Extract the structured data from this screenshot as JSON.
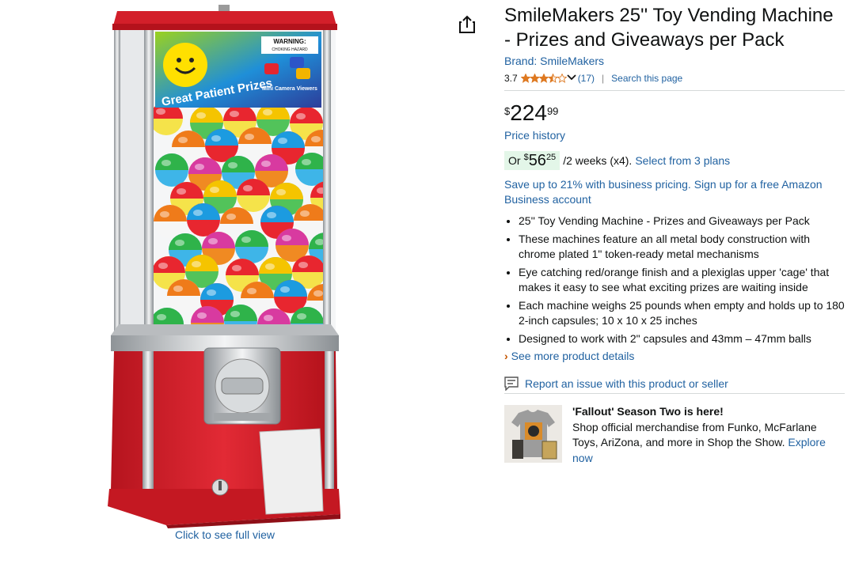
{
  "product": {
    "title": "SmileMakers 25'' Toy Vending Machine - Prizes and Giveaways per Pack",
    "brand": "Brand: SmileMakers",
    "rating_value": "3.7",
    "rating_stars": 3.5,
    "rating_count": "(17)",
    "search_page": "Search this page"
  },
  "price": {
    "symbol": "$",
    "whole": "224",
    "fraction": "99",
    "history_link": "Price history"
  },
  "installment": {
    "or": "Or",
    "symbol": "$",
    "whole": "56",
    "fraction": "25",
    "per": "/2 weeks (x4).",
    "plans_link": "Select from 3 plans"
  },
  "business": "Save up to 21% with business pricing. Sign up for a free Amazon Business account",
  "bullets": [
    "25'' Toy Vending Machine - Prizes and Giveaways per Pack",
    "These machines feature an all metal body construction with chrome plated 1\" token-ready metal mechanisms",
    "Eye catching red/orange finish and a plexiglas upper 'cage' that makes it easy to see what exciting prizes are waiting inside",
    "Each machine weighs 25 pounds when empty and holds up to 180 2-inch capsules; 10 x 10 x 25 inches",
    "Designed to work with 2\" capsules and 43mm – 47mm balls"
  ],
  "see_more": "See more product details",
  "report_issue": "Report an issue with this product or seller",
  "promo": {
    "title": "'Fallout' Season Two is here!",
    "body": "Shop official merchandise from Funko, McFarlane Toys, AriZona, and more in Shop the Show.",
    "link": "Explore now"
  },
  "image": {
    "click_full_view": "Click to see full view",
    "sign_text": "Great Patient Prizes",
    "sign_sub": "Mini Camera Viewers",
    "warning": "WARNING:",
    "warning_sub": "CHOKING HAZARD",
    "brand_mark": "SmileMakers"
  },
  "colors": {
    "link": "#2162a1",
    "star": "#de7921",
    "installment_bg": "#e3f6e8",
    "machine_red": "#d8232f"
  },
  "icons": [
    "share-icon",
    "star-icon",
    "chevron-down-icon",
    "chevron-right-icon",
    "report-icon"
  ]
}
